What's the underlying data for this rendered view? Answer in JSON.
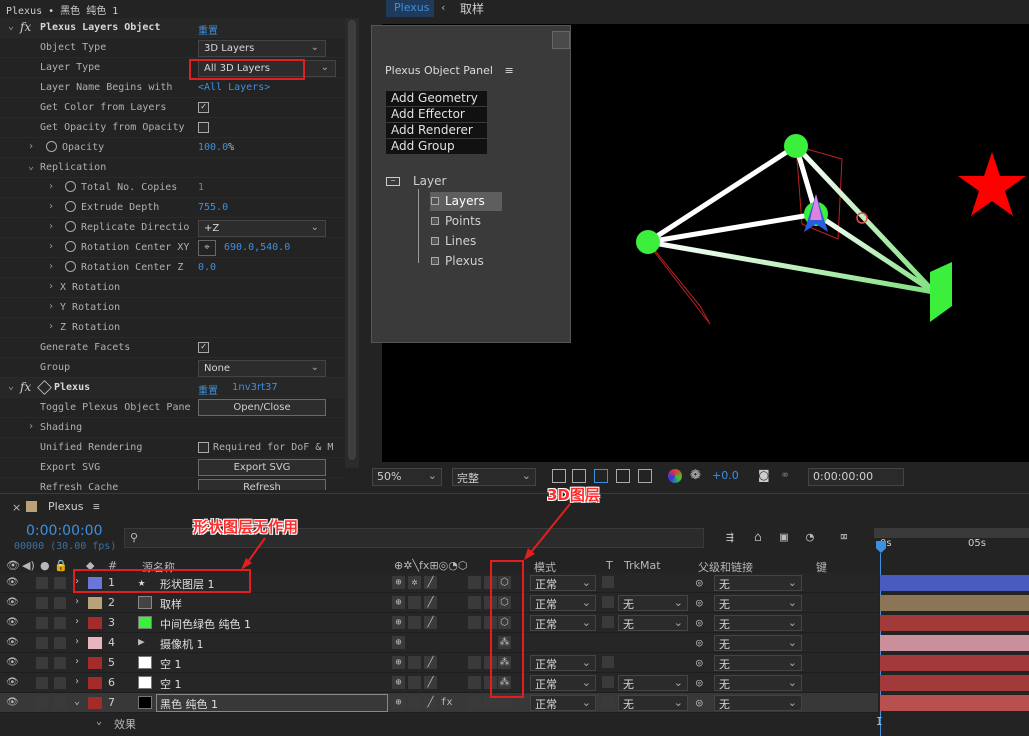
{
  "effect_controls": {
    "title": "Plexus • 黑色 纯色 1",
    "effect1": {
      "name": "Plexus Layers Object",
      "reset": "重置"
    },
    "props": [
      {
        "label": "Object Type",
        "value": "3D Layers"
      },
      {
        "label": "Layer Type",
        "value": "All 3D Layers"
      },
      {
        "label": "Layer Name Begins with",
        "value": "<All Layers>"
      },
      {
        "label": "Get Color from Layers",
        "checked": true
      },
      {
        "label": "Get Opacity from Opacity",
        "checked": false
      },
      {
        "label": "Opacity",
        "value": "100.0",
        "unit": "%"
      },
      {
        "label": "Replication"
      },
      {
        "label": "Total No. Copies",
        "value": "1"
      },
      {
        "label": "Extrude Depth",
        "value": "755.0"
      },
      {
        "label": "Replicate Directio",
        "value": "+Z"
      },
      {
        "label": "Rotation Center XY",
        "value": "690.0,540.0"
      },
      {
        "label": "Rotation Center Z",
        "value": "0.0"
      },
      {
        "label": "X Rotation"
      },
      {
        "label": "Y Rotation"
      },
      {
        "label": "Z Rotation"
      },
      {
        "label": "Generate Facets",
        "checked": true
      },
      {
        "label": "Group",
        "value": "None"
      }
    ],
    "effect2": {
      "name": "Plexus",
      "reset": "重置",
      "extra": "1nv3rt37"
    },
    "props2": [
      {
        "label": "Toggle Plexus Object Pane",
        "button": "Open/Close"
      },
      {
        "label": "Shading"
      },
      {
        "label": "Unified Rendering",
        "check_label": "Required for DoF & M"
      },
      {
        "label": "Export SVG",
        "button": "Export SVG"
      },
      {
        "label": "Refresh Cache",
        "button": "Refresh"
      }
    ]
  },
  "comp": {
    "tab": "Plexus",
    "tab2": "取样",
    "zoom": "50%",
    "quality": "完整",
    "exposure": "+0.0",
    "timecode": "0:00:00:00"
  },
  "plexus_panel": {
    "title": "Plexus Object Panel",
    "menu_icon": "≡",
    "buttons": [
      "Add Geometry",
      "Add Effector",
      "Add Renderer",
      "Add Group"
    ],
    "tree_root": "Layer",
    "tree_items": [
      "Layers",
      "Points",
      "Lines",
      "Plexus"
    ]
  },
  "timeline": {
    "comp_name": "Plexus",
    "time": "0:00:00:00",
    "frames": "00000 (30.00 fps)",
    "search_placeholder": "",
    "headers": {
      "source": "源名称",
      "mode": "模式",
      "t": "T",
      "trkmat": "TrkMat",
      "parent": "父级和链接",
      "keys": "键"
    },
    "ruler": [
      "0s",
      "05s"
    ],
    "layers": [
      {
        "num": "1",
        "name": "形状图层 1",
        "label_color": "#6b77d6",
        "mode": "正常",
        "trk": "",
        "parent": "无",
        "bar": "#4a5bbf",
        "icon": "star"
      },
      {
        "num": "2",
        "name": "取样",
        "label_color": "#b9a27a",
        "mode": "正常",
        "trk": "无",
        "parent": "无",
        "bar": "#8a7656",
        "icon": "comp"
      },
      {
        "num": "3",
        "name": "中间色绿色 纯色 1",
        "label_color": "#a52a2a",
        "mode": "正常",
        "trk": "无",
        "parent": "无",
        "bar": "#a23a3a",
        "icon": "green"
      },
      {
        "num": "4",
        "name": "摄像机 1",
        "label_color": "#e8b4bf",
        "mode": "",
        "trk": "",
        "parent": "无",
        "bar": "#c9909c",
        "icon": "camera"
      },
      {
        "num": "5",
        "name": "空 1",
        "label_color": "#a52a2a",
        "mode": "正常",
        "trk": "",
        "parent": "无",
        "bar": "#a23a3a",
        "icon": "white"
      },
      {
        "num": "6",
        "name": "空 1",
        "label_color": "#a52a2a",
        "mode": "正常",
        "trk": "无",
        "parent": "无",
        "bar": "#a23a3a",
        "icon": "white"
      },
      {
        "num": "7",
        "name": "黑色 纯色 1",
        "label_color": "#a52a2a",
        "mode": "正常",
        "trk": "无",
        "parent": "无",
        "bar": "#b85050",
        "icon": "black"
      }
    ],
    "effects_label": "效果"
  },
  "annotations": {
    "shape_note": "形状图层无作用",
    "threed_note": "3D图层"
  }
}
